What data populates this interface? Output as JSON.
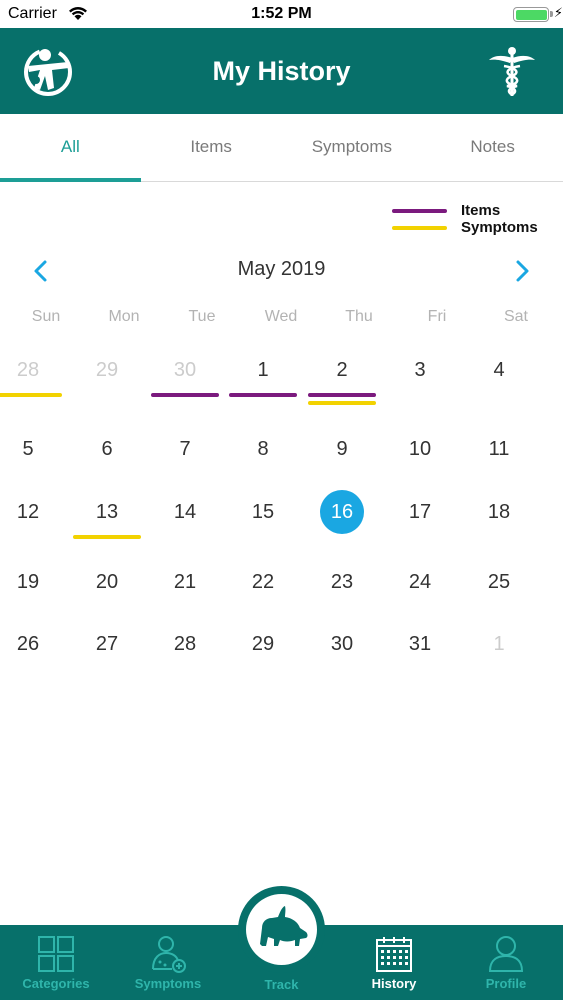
{
  "status_bar": {
    "carrier": "Carrier",
    "time": "1:52 PM"
  },
  "header": {
    "title": "My History"
  },
  "tabs": [
    {
      "label": "All",
      "active": true
    },
    {
      "label": "Items",
      "active": false
    },
    {
      "label": "Symptoms",
      "active": false
    },
    {
      "label": "Notes",
      "active": false
    }
  ],
  "legend": [
    {
      "label": "Items",
      "color": "#7b1a7e"
    },
    {
      "label": "Symptoms",
      "color": "#f2d200"
    }
  ],
  "calendar": {
    "month_title": "May 2019",
    "weekdays": [
      "Sun",
      "Mon",
      "Tue",
      "Wed",
      "Thu",
      "Fri",
      "Sat"
    ],
    "weeks": [
      [
        {
          "day": "28",
          "muted": true,
          "items": false,
          "symptoms": true
        },
        {
          "day": "29",
          "muted": true,
          "items": false,
          "symptoms": false
        },
        {
          "day": "30",
          "muted": true,
          "items": true,
          "symptoms": false
        },
        {
          "day": "1",
          "muted": false,
          "items": true,
          "symptoms": false
        },
        {
          "day": "2",
          "muted": false,
          "items": true,
          "symptoms": true
        },
        {
          "day": "3",
          "muted": false,
          "items": false,
          "symptoms": false
        },
        {
          "day": "4",
          "muted": false,
          "items": false,
          "symptoms": false
        }
      ],
      [
        {
          "day": "5"
        },
        {
          "day": "6"
        },
        {
          "day": "7"
        },
        {
          "day": "8"
        },
        {
          "day": "9"
        },
        {
          "day": "10"
        },
        {
          "day": "11"
        }
      ],
      [
        {
          "day": "12"
        },
        {
          "day": "13",
          "symptoms": true
        },
        {
          "day": "14"
        },
        {
          "day": "15"
        },
        {
          "day": "16",
          "today": true
        },
        {
          "day": "17"
        },
        {
          "day": "18"
        }
      ],
      [
        {
          "day": "19"
        },
        {
          "day": "20"
        },
        {
          "day": "21"
        },
        {
          "day": "22"
        },
        {
          "day": "23"
        },
        {
          "day": "24"
        },
        {
          "day": "25"
        }
      ],
      [
        {
          "day": "26"
        },
        {
          "day": "27"
        },
        {
          "day": "28"
        },
        {
          "day": "29"
        },
        {
          "day": "30"
        },
        {
          "day": "31"
        },
        {
          "day": "1",
          "muted": true
        }
      ]
    ]
  },
  "tabbar": {
    "items": [
      {
        "label": "Categories",
        "icon": "grid-icon",
        "active": false
      },
      {
        "label": "Symptoms",
        "icon": "person-plus-icon",
        "active": false
      },
      {
        "label": "History",
        "icon": "calendar-icon",
        "active": true
      },
      {
        "label": "Profile",
        "icon": "user-icon",
        "active": false
      }
    ],
    "track_label": "Track"
  },
  "colors": {
    "brand": "#07706a",
    "tab_accent": "#1d9e96",
    "today": "#1aa7e2",
    "items": "#7b1a7e",
    "symptoms": "#f2d200"
  }
}
